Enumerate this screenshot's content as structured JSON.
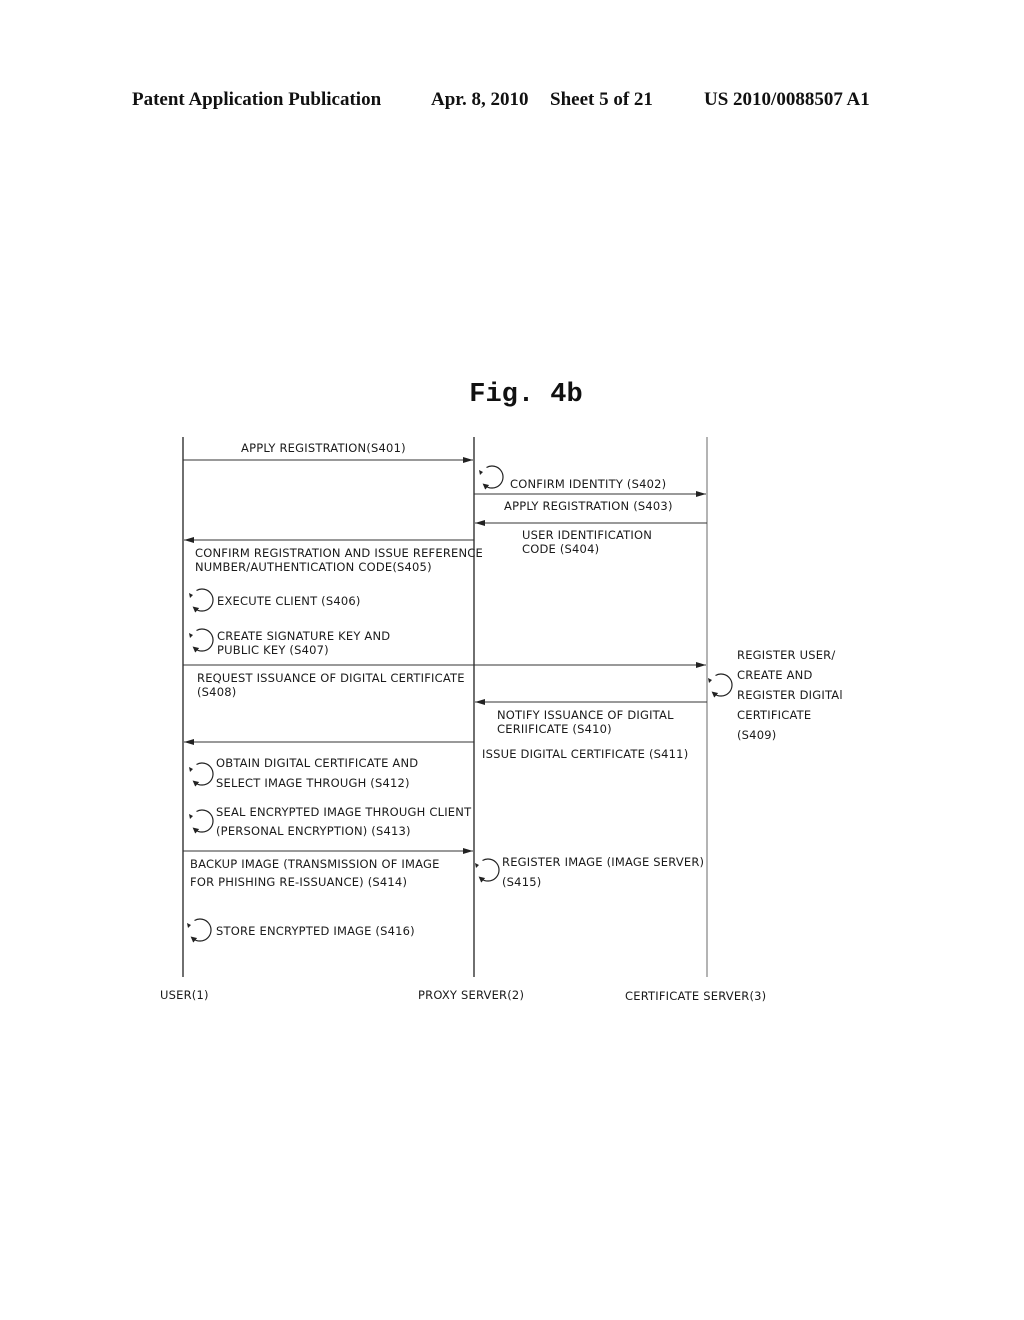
{
  "header": {
    "publication": "Patent Application Publication",
    "date": "Apr. 8, 2010",
    "sheet": "Sheet 5 of 21",
    "number": "US 2010/0088507 A1"
  },
  "figure": {
    "title": "Fig. 4b"
  },
  "participants": [
    {
      "id": "user",
      "label": "USER(1)"
    },
    {
      "id": "proxy",
      "label": "PROXY SERVER(2)"
    },
    {
      "id": "cert",
      "label": "CERTIFICATE SERVER(3)"
    }
  ],
  "steps": [
    {
      "id": "S401",
      "type": "message",
      "from": "user",
      "to": "proxy",
      "lines": [
        "APPLY REGISTRATION(S401)"
      ]
    },
    {
      "id": "S402",
      "type": "process",
      "at": "proxy",
      "lines": [
        "CONFIRM IDENTITY (S402)"
      ]
    },
    {
      "id": "S403",
      "type": "message",
      "from": "proxy",
      "to": "cert",
      "lines": [
        "APPLY REGISTRATION (S403)"
      ]
    },
    {
      "id": "S404",
      "type": "message",
      "from": "cert",
      "to": "proxy",
      "lines": [
        "USER IDENTIFICATION",
        "CODE (S404)"
      ]
    },
    {
      "id": "S405",
      "type": "message",
      "from": "proxy",
      "to": "user",
      "lines": [
        "CONFIRM REGISTRATION AND ISSUE REFERENCE",
        "NUMBER/AUTHENTICATION CODE(S405)"
      ]
    },
    {
      "id": "S406",
      "type": "process",
      "at": "user",
      "lines": [
        "EXECUTE CLIENT (S406)"
      ]
    },
    {
      "id": "S407",
      "type": "process",
      "at": "user",
      "lines": [
        "CREATE SIGNATURE KEY AND",
        "PUBLIC KEY (S407)"
      ]
    },
    {
      "id": "S408",
      "type": "message",
      "from": "user",
      "to": "cert",
      "lines": [
        "REQUEST ISSUANCE OF DIGITAL CERTIFICATE",
        "(S408)"
      ]
    },
    {
      "id": "S409",
      "type": "process",
      "at": "cert",
      "lines": [
        "REGISTER USER/",
        "CREATE AND",
        "REGISTER DIGITAl",
        "CERTIFICATE",
        "(S409)"
      ]
    },
    {
      "id": "S410",
      "type": "message",
      "from": "cert",
      "to": "proxy",
      "lines": [
        "NOTIFY ISSUANCE OF DIGITAL",
        "CERIIFICATE (S410)"
      ]
    },
    {
      "id": "S411",
      "type": "message",
      "from": "proxy",
      "to": "user",
      "lines": [
        "ISSUE DIGITAL CERTIFICATE (S411)"
      ]
    },
    {
      "id": "S412",
      "type": "process",
      "at": "user",
      "lines": [
        "OBTAIN DIGITAL CERTIFICATE AND",
        "SELECT IMAGE THROUGH (S412)"
      ]
    },
    {
      "id": "S413",
      "type": "process",
      "at": "user",
      "lines": [
        "SEAL ENCRYPTED IMAGE THROUGH CLIENT",
        "(PERSONAL ENCRYPTION) (S413)"
      ]
    },
    {
      "id": "S414",
      "type": "message",
      "from": "user",
      "to": "proxy",
      "lines": [
        "BACKUP IMAGE (TRANSMISSION OF IMAGE",
        "FOR PHISHING RE-ISSUANCE) (S414)"
      ]
    },
    {
      "id": "S415",
      "type": "process",
      "at": "proxy",
      "lines": [
        "REGISTER IMAGE (IMAGE SERVER)",
        "(S415)"
      ]
    },
    {
      "id": "S416",
      "type": "process",
      "at": "user",
      "lines": [
        "STORE ENCRYPTED IMAGE (S416)"
      ]
    }
  ]
}
